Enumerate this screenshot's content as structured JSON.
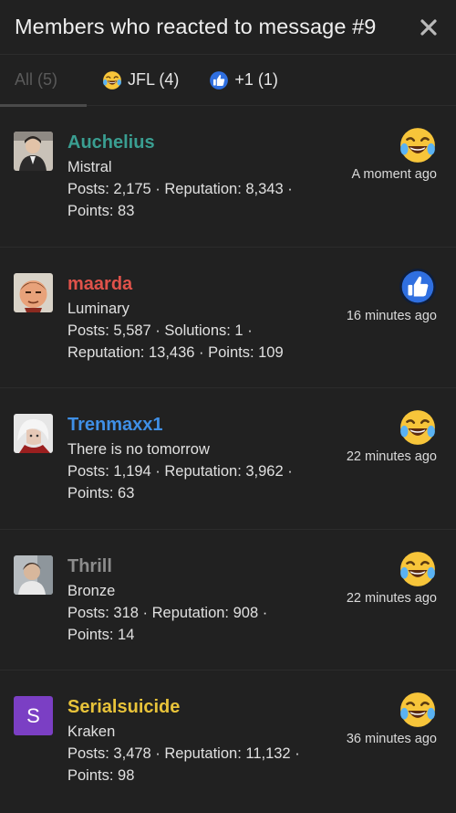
{
  "header": {
    "title": "Members who reacted to message #9",
    "close_icon": "close-icon"
  },
  "tabs": [
    {
      "label": "All (5)",
      "icon": ""
    },
    {
      "label": "JFL (4)",
      "icon": "laugh-cry-emoji-icon"
    },
    {
      "label": "+1 (1)",
      "icon": "thumbs-up-icon"
    }
  ],
  "members": [
    {
      "name": "Auchelius",
      "name_color": "#3a9e91",
      "title": "Mistral",
      "stats_line1": "Posts: 2,175 · Reputation: 8,343 ·",
      "stats_line2": "Points: 83",
      "reaction": "laugh-cry-emoji-icon",
      "time": "A moment ago",
      "avatar_icon": "user-photo-avatar"
    },
    {
      "name": "maarda",
      "name_color": "#e0524a",
      "title": "Luminary",
      "stats_line1": "Posts: 5,587 · Solutions: 1 ·",
      "stats_line2": "Reputation: 13,436 · Points: 109",
      "reaction": "thumbs-up-icon",
      "time": "16 minutes ago",
      "avatar_icon": "cartoon-face-avatar"
    },
    {
      "name": "Trenmaxx1",
      "name_color": "#3f8fe6",
      "title": "There is no tomorrow",
      "stats_line1": "Posts: 1,194 · Reputation: 3,962 ·",
      "stats_line2": "Points: 63",
      "reaction": "laugh-cry-emoji-icon",
      "time": "22 minutes ago",
      "avatar_icon": "white-hair-avatar"
    },
    {
      "name": "Thrill",
      "name_color": "#8c8c8c",
      "title": "Bronze",
      "stats_line1": "Posts: 318 · Reputation: 908 ·",
      "stats_line2": "Points: 14",
      "reaction": "laugh-cry-emoji-icon",
      "time": "22 minutes ago",
      "avatar_icon": "user-photo-avatar"
    },
    {
      "name": "Serialsuicide",
      "name_color": "#e8c33a",
      "title": "Kraken",
      "stats_line1": "Posts: 3,478 · Reputation: 11,132 ·",
      "stats_line2": "Points: 98",
      "reaction": "laugh-cry-emoji-icon",
      "time": "36 minutes ago",
      "avatar_letter": "S",
      "avatar_color": "#7b3fc4"
    }
  ]
}
